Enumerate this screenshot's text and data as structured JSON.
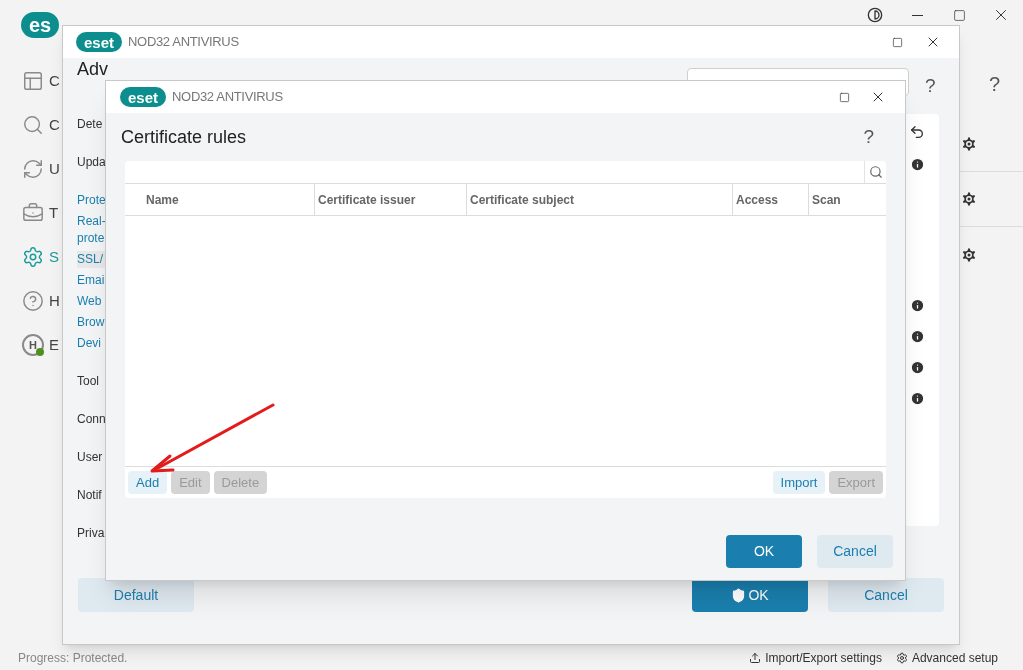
{
  "background_app": {
    "logo": "es",
    "help": "?",
    "sidebar": [
      {
        "kind": "dashboard",
        "label": "C",
        "selected": false
      },
      {
        "kind": "scan",
        "label": "C",
        "selected": false
      },
      {
        "kind": "update",
        "label": "U",
        "selected": false
      },
      {
        "kind": "tools",
        "label": "T",
        "selected": false
      },
      {
        "kind": "setup",
        "label": "S",
        "selected": true
      },
      {
        "kind": "help",
        "label": "H",
        "selected": false
      },
      {
        "kind": "account",
        "label": "E",
        "selected": false,
        "initial": "H"
      }
    ]
  },
  "settings_window": {
    "logo": "eset",
    "product": "NOD32 ANTIVIRUS",
    "title": "Adv",
    "help": "?",
    "nav": [
      {
        "kind": "heading",
        "lines": [
          "Dete"
        ],
        "selected": false
      },
      {
        "kind": "heading",
        "lines": [
          "Upda"
        ],
        "selected": false
      },
      {
        "kind": "link",
        "lines": [
          "Prote"
        ],
        "selected": false
      },
      {
        "kind": "link",
        "lines": [
          "Real-",
          "prote"
        ],
        "selected": false
      },
      {
        "kind": "link",
        "lines": [
          "SSL/"
        ],
        "selected": true
      },
      {
        "kind": "link",
        "lines": [
          "Emai"
        ],
        "selected": false
      },
      {
        "kind": "link",
        "lines": [
          "Web"
        ],
        "selected": false
      },
      {
        "kind": "link",
        "lines": [
          "Brow"
        ],
        "selected": false
      },
      {
        "kind": "link",
        "lines": [
          "Devi"
        ],
        "selected": false
      },
      {
        "kind": "heading",
        "lines": [
          "Tool"
        ],
        "selected": false
      },
      {
        "kind": "heading",
        "lines": [
          "Conn"
        ],
        "selected": false
      },
      {
        "kind": "heading",
        "lines": [
          "User"
        ],
        "selected": false
      },
      {
        "kind": "heading",
        "lines": [
          "Notif"
        ],
        "selected": false
      },
      {
        "kind": "heading",
        "lines": [
          "Priva"
        ],
        "selected": false
      }
    ],
    "buttons": [
      {
        "kind": "secondary",
        "label": "Default"
      },
      {
        "kind": "primary",
        "label": "OK",
        "shield": true
      },
      {
        "kind": "secondary",
        "label": "Cancel"
      }
    ]
  },
  "dialog": {
    "logo": "eset",
    "product": "NOD32 ANTIVIRUS",
    "title": "Certificate rules",
    "help": "?",
    "table": {
      "columns": [
        "Name",
        "Certificate issuer",
        "Certificate subject",
        "Access",
        "Scan"
      ]
    },
    "left_buttons": [
      {
        "label": "Add",
        "disabled": false
      },
      {
        "label": "Edit",
        "disabled": true
      },
      {
        "label": "Delete",
        "disabled": true
      }
    ],
    "right_buttons": [
      {
        "label": "Import",
        "disabled": false
      },
      {
        "label": "Export",
        "disabled": true
      }
    ],
    "buttons": [
      {
        "kind": "primary",
        "label": "OK"
      },
      {
        "kind": "secondary",
        "label": "Cancel"
      }
    ]
  },
  "status_bar": {
    "text": "Progress: Protected.",
    "links": [
      "Import/Export settings",
      "Advanced setup"
    ]
  }
}
